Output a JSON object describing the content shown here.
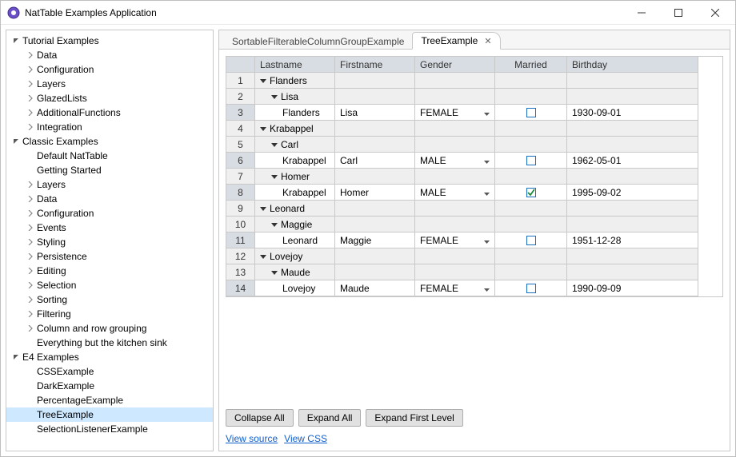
{
  "titlebar": {
    "title": "NatTable Examples Application"
  },
  "sidebar": {
    "items": [
      {
        "label": "Tutorial Examples",
        "depth": 0,
        "exp": "open"
      },
      {
        "label": "Data",
        "depth": 1,
        "exp": "closed"
      },
      {
        "label": "Configuration",
        "depth": 1,
        "exp": "closed"
      },
      {
        "label": "Layers",
        "depth": 1,
        "exp": "closed"
      },
      {
        "label": "GlazedLists",
        "depth": 1,
        "exp": "closed"
      },
      {
        "label": "AdditionalFunctions",
        "depth": 1,
        "exp": "closed"
      },
      {
        "label": "Integration",
        "depth": 1,
        "exp": "closed"
      },
      {
        "label": "Classic Examples",
        "depth": 0,
        "exp": "open"
      },
      {
        "label": "Default NatTable",
        "depth": 1,
        "exp": "none"
      },
      {
        "label": "Getting Started",
        "depth": 1,
        "exp": "none"
      },
      {
        "label": "Layers",
        "depth": 1,
        "exp": "closed"
      },
      {
        "label": "Data",
        "depth": 1,
        "exp": "closed"
      },
      {
        "label": "Configuration",
        "depth": 1,
        "exp": "closed"
      },
      {
        "label": "Events",
        "depth": 1,
        "exp": "closed"
      },
      {
        "label": "Styling",
        "depth": 1,
        "exp": "closed"
      },
      {
        "label": "Persistence",
        "depth": 1,
        "exp": "closed"
      },
      {
        "label": "Editing",
        "depth": 1,
        "exp": "closed"
      },
      {
        "label": "Selection",
        "depth": 1,
        "exp": "closed"
      },
      {
        "label": "Sorting",
        "depth": 1,
        "exp": "closed"
      },
      {
        "label": "Filtering",
        "depth": 1,
        "exp": "closed"
      },
      {
        "label": "Column and row grouping",
        "depth": 1,
        "exp": "closed"
      },
      {
        "label": "Everything but the kitchen sink",
        "depth": 1,
        "exp": "none"
      },
      {
        "label": "E4 Examples",
        "depth": 0,
        "exp": "open"
      },
      {
        "label": "CSSExample",
        "depth": 1,
        "exp": "none"
      },
      {
        "label": "DarkExample",
        "depth": 1,
        "exp": "none"
      },
      {
        "label": "PercentageExample",
        "depth": 1,
        "exp": "none"
      },
      {
        "label": "TreeExample",
        "depth": 1,
        "exp": "none",
        "selected": true
      },
      {
        "label": "SelectionListenerExample",
        "depth": 1,
        "exp": "none"
      }
    ]
  },
  "tabs": [
    {
      "label": "SortableFilterableColumnGroupExample",
      "active": false
    },
    {
      "label": "TreeExample",
      "active": true
    }
  ],
  "table": {
    "cols": {
      "lastname": "Lastname",
      "firstname": "Firstname",
      "gender": "Gender",
      "married": "Married",
      "birthday": "Birthday"
    },
    "rows": [
      {
        "n": "1",
        "group": true,
        "indent": 0,
        "lastname": "Flanders"
      },
      {
        "n": "2",
        "group": true,
        "indent": 1,
        "lastname": "Lisa"
      },
      {
        "n": "3",
        "group": false,
        "indent": 2,
        "lastname": "Flanders",
        "firstname": "Lisa",
        "gender": "FEMALE",
        "married": false,
        "birthday": "1930-09-01"
      },
      {
        "n": "4",
        "group": true,
        "indent": 0,
        "lastname": "Krabappel"
      },
      {
        "n": "5",
        "group": true,
        "indent": 1,
        "lastname": "Carl"
      },
      {
        "n": "6",
        "group": false,
        "indent": 2,
        "lastname": "Krabappel",
        "firstname": "Carl",
        "gender": "MALE",
        "married": false,
        "birthday": "1962-05-01"
      },
      {
        "n": "7",
        "group": true,
        "indent": 1,
        "lastname": "Homer"
      },
      {
        "n": "8",
        "group": false,
        "indent": 2,
        "lastname": "Krabappel",
        "firstname": "Homer",
        "gender": "MALE",
        "married": true,
        "birthday": "1995-09-02"
      },
      {
        "n": "9",
        "group": true,
        "indent": 0,
        "lastname": "Leonard"
      },
      {
        "n": "10",
        "group": true,
        "indent": 1,
        "lastname": "Maggie"
      },
      {
        "n": "11",
        "group": false,
        "indent": 2,
        "lastname": "Leonard",
        "firstname": "Maggie",
        "gender": "FEMALE",
        "married": false,
        "birthday": "1951-12-28"
      },
      {
        "n": "12",
        "group": true,
        "indent": 0,
        "lastname": "Lovejoy"
      },
      {
        "n": "13",
        "group": true,
        "indent": 1,
        "lastname": "Maude"
      },
      {
        "n": "14",
        "group": false,
        "indent": 2,
        "lastname": "Lovejoy",
        "firstname": "Maude",
        "gender": "FEMALE",
        "married": false,
        "birthday": "1990-09-09"
      }
    ]
  },
  "buttons": {
    "collapse": "Collapse All",
    "expand": "Expand All",
    "expandFirst": "Expand First Level"
  },
  "links": {
    "source": "View source",
    "css": "View CSS"
  }
}
